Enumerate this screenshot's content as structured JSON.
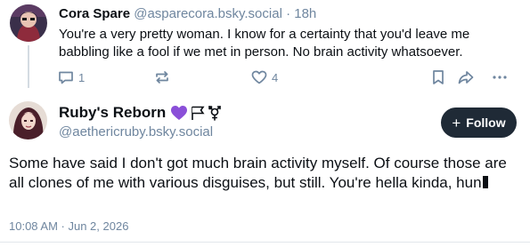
{
  "parent_post": {
    "author_name": "Cora Spare",
    "author_handle": "@asparecora.bsky.social",
    "separator": "·",
    "timestamp": "18h",
    "text": "You're a very pretty woman. I know for a certainty that you'd leave me babbling like a fool if we met in person. No brain activity whatsoever.",
    "actions": {
      "reply_count": "1",
      "repost_count": "",
      "like_count": "4",
      "icons": [
        "reply-icon",
        "repost-icon",
        "like-icon",
        "bookmark-icon",
        "share-icon",
        "more-icon"
      ]
    }
  },
  "main_post": {
    "author_name": "Ruby's Reborn",
    "author_handle": "@aethericruby.bsky.social",
    "name_emojis": [
      "purple-heart-icon",
      "flag-icon",
      "transgender-symbol-icon"
    ],
    "follow_label": "Follow",
    "text": "Some have said I don't got much brain activity myself. Of course those are all clones of me with various disguises, but still. You're hella kinda, hun",
    "trailing_glyph": "unknown-glyph",
    "datetime": "10:08 AM · Jun 2, 2026"
  },
  "colors": {
    "text_primary": "#0b0f14",
    "text_secondary": "#6f869f",
    "follow_bg": "#1f2a36",
    "thread_line": "#d4dbe2",
    "heart": "#8a4fd8"
  }
}
